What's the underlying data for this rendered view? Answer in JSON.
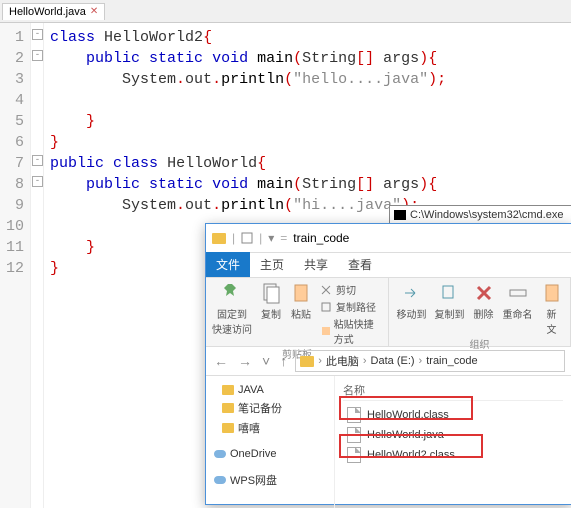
{
  "tab": {
    "filename": "HelloWorld.java"
  },
  "gutter": [
    "1",
    "2",
    "3",
    "4",
    "5",
    "6",
    "7",
    "8",
    "9",
    "10",
    "11",
    "12"
  ],
  "code": {
    "l1": {
      "kw": "class",
      "name": "HelloWorld2",
      "brace": "{"
    },
    "l2": {
      "mods": "public static",
      "type": "void",
      "fn": "main",
      "args": "String",
      "arr": "[]",
      "p": "args",
      "open": "(",
      "close": ")",
      "brace": "{"
    },
    "l3": {
      "obj": "System",
      "d1": ".",
      "out": "out",
      "d2": ".",
      "m": "println",
      "open": "(",
      "str": "\"hello....java\"",
      "close": ")",
      "semi": ";"
    },
    "l5": {
      "brace": "}"
    },
    "l6": {
      "brace": "}"
    },
    "l7": {
      "mods": "public",
      "kw": "class",
      "name": "HelloWorld",
      "brace": "{"
    },
    "l8": {
      "mods": "public static",
      "type": "void",
      "fn": "main",
      "args": "String",
      "arr": "[]",
      "p": "args",
      "open": "(",
      "close": ")",
      "brace": "{"
    },
    "l9": {
      "obj": "System",
      "d1": ".",
      "out": "out",
      "d2": ".",
      "m": "println",
      "open": "(",
      "str": "\"hi....java\"",
      "close": ")",
      "semi": ";"
    },
    "l11": {
      "brace": "}"
    },
    "l12": {
      "brace": "}"
    }
  },
  "cmd": {
    "title": "C:\\Windows\\system32\\cmd.exe"
  },
  "explorer": {
    "title": "train_code",
    "tabs": {
      "file": "文件",
      "home": "主页",
      "share": "共享",
      "view": "查看"
    },
    "ribbon": {
      "pin": "固定到\n快速访问",
      "copy": "复制",
      "paste": "粘贴",
      "cut": "剪切",
      "copypath": "复制路径",
      "pasteshort": "粘贴快捷方式",
      "clipboard_label": "剪贴板",
      "moveto": "移动到",
      "copyto": "复制到",
      "delete": "删除",
      "rename": "重命名",
      "new": "新\n文",
      "organize_label": "组织"
    },
    "breadcrumb": {
      "pc": "此电脑",
      "drive": "Data (E:)",
      "folder": "train_code"
    },
    "tree": {
      "java": "JAVA",
      "notes": "笔记备份",
      "other": "嘻嘻",
      "onedrive": "OneDrive",
      "wps": "WPS网盘"
    },
    "files": {
      "header": "名称",
      "f1": "HelloWorld.class",
      "f2": "HelloWorld.java",
      "f3": "HelloWorld2.class"
    }
  }
}
